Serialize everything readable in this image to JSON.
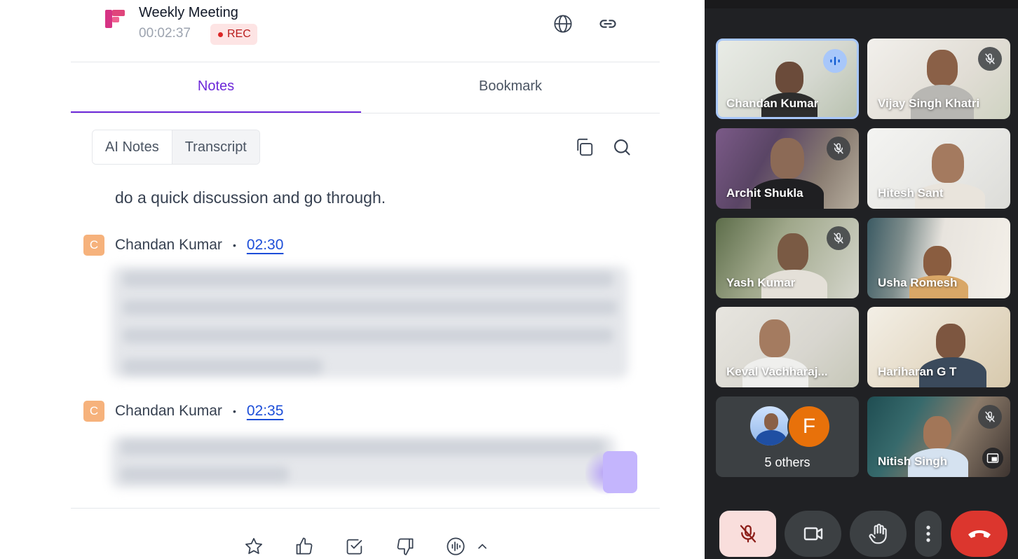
{
  "meeting": {
    "title": "Weekly Meeting",
    "elapsed": "00:02:37",
    "rec_label": "REC"
  },
  "tabs": [
    {
      "label": "Notes",
      "active": true
    },
    {
      "label": "Bookmark",
      "active": false
    }
  ],
  "segments": [
    {
      "label": "AI Notes",
      "active": true
    },
    {
      "label": "Transcript",
      "active": false
    }
  ],
  "transcript": {
    "partial_line": "do a quick discussion and go through.",
    "entries": [
      {
        "avatar": "C",
        "speaker": "Chandan Kumar",
        "timestamp": "02:30",
        "blurred": true
      },
      {
        "avatar": "C",
        "speaker": "Chandan Kumar",
        "timestamp": "02:35",
        "blurred": true
      }
    ]
  },
  "feedback_icons": [
    "star-icon",
    "thumbs-up-icon",
    "checkbox-icon",
    "thumbs-down-icon",
    "audio-wave-icon",
    "chevron-up-icon"
  ],
  "participants": [
    {
      "name": "Chandan Kumar",
      "status": "speaking"
    },
    {
      "name": "Vijay Singh Khatri",
      "status": "muted"
    },
    {
      "name": "Archit Shukla",
      "status": "muted"
    },
    {
      "name": "Hitesh Sant",
      "status": "none"
    },
    {
      "name": "Yash Kumar",
      "status": "muted"
    },
    {
      "name": "Usha Romesh",
      "status": "none"
    },
    {
      "name": "Keval Vachharaj...",
      "status": "none"
    },
    {
      "name": "Hariharan G T",
      "status": "none"
    },
    {
      "name": "Nitish Singh",
      "status": "muted"
    }
  ],
  "others": {
    "label": "5 others",
    "avatar_letter": "F"
  },
  "controls": [
    "mic-off-icon",
    "camera-icon",
    "raise-hand-icon",
    "more-icon",
    "end-call-icon"
  ],
  "colors": {
    "accent": "#6d28d9",
    "link": "#1d4ed8",
    "rec_bg": "#fde4e4",
    "meet_bg": "#202124",
    "end_call": "#dc362e",
    "mic_off_bg": "#f9dedc",
    "speaking": "#a8c7fa"
  }
}
